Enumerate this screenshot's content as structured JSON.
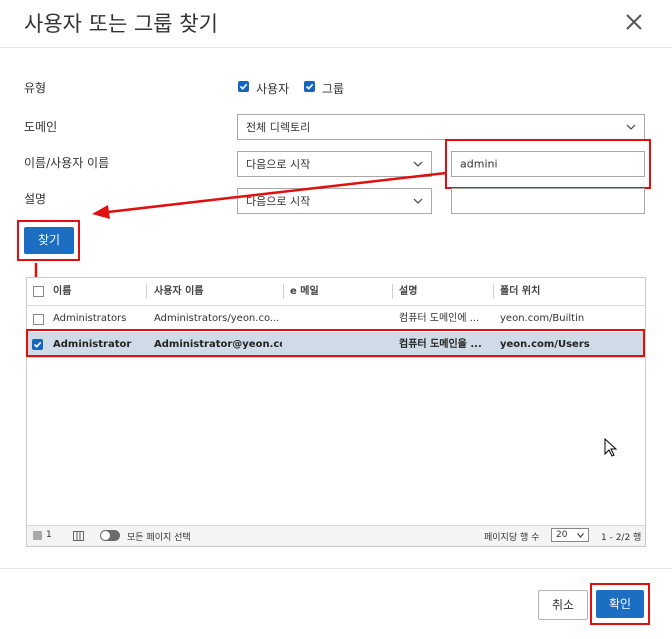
{
  "dialog": {
    "title": "사용자 또는 그룹 찾기",
    "close_icon": "close-icon"
  },
  "form": {
    "type_label": "유형",
    "type_user": "사용자",
    "type_group": "그룹",
    "domain_label": "도메인",
    "domain_value": "전체 디렉토리",
    "name_label": "이름/사용자 이름",
    "name_mode": "다음으로 시작",
    "name_value": "admini",
    "desc_label": "설명",
    "desc_mode": "다음으로 시작",
    "desc_value": "",
    "find_button": "찾기"
  },
  "grid": {
    "columns": [
      "이름",
      "사용자 이름",
      "e 메일",
      "설명",
      "폴더 위치"
    ],
    "rows": [
      {
        "name": "Administrators",
        "username": "Administrators/yeon.co...",
        "email": "",
        "description": "컴퓨터 도메인에 ...",
        "folder": "yeon.com/Builtin",
        "selected": false
      },
      {
        "name": "Administrator",
        "username": "Administrator@yeon.co...",
        "email": "",
        "description": "컴퓨터 도메인을 ...",
        "folder": "yeon.com/Users",
        "selected": true
      }
    ],
    "footer": {
      "selected_count": "1",
      "select_all_pages": "모든 페이지 선택",
      "rows_per_page_label": "페이지당 행 수",
      "rows_per_page": "20",
      "range": "1 - 2/2 행"
    }
  },
  "buttons": {
    "cancel": "취소",
    "ok": "확인"
  },
  "colors": {
    "primary": "#1b6ec2",
    "annotation_red": "#e01010",
    "selected_row": "#cfdbe6"
  }
}
